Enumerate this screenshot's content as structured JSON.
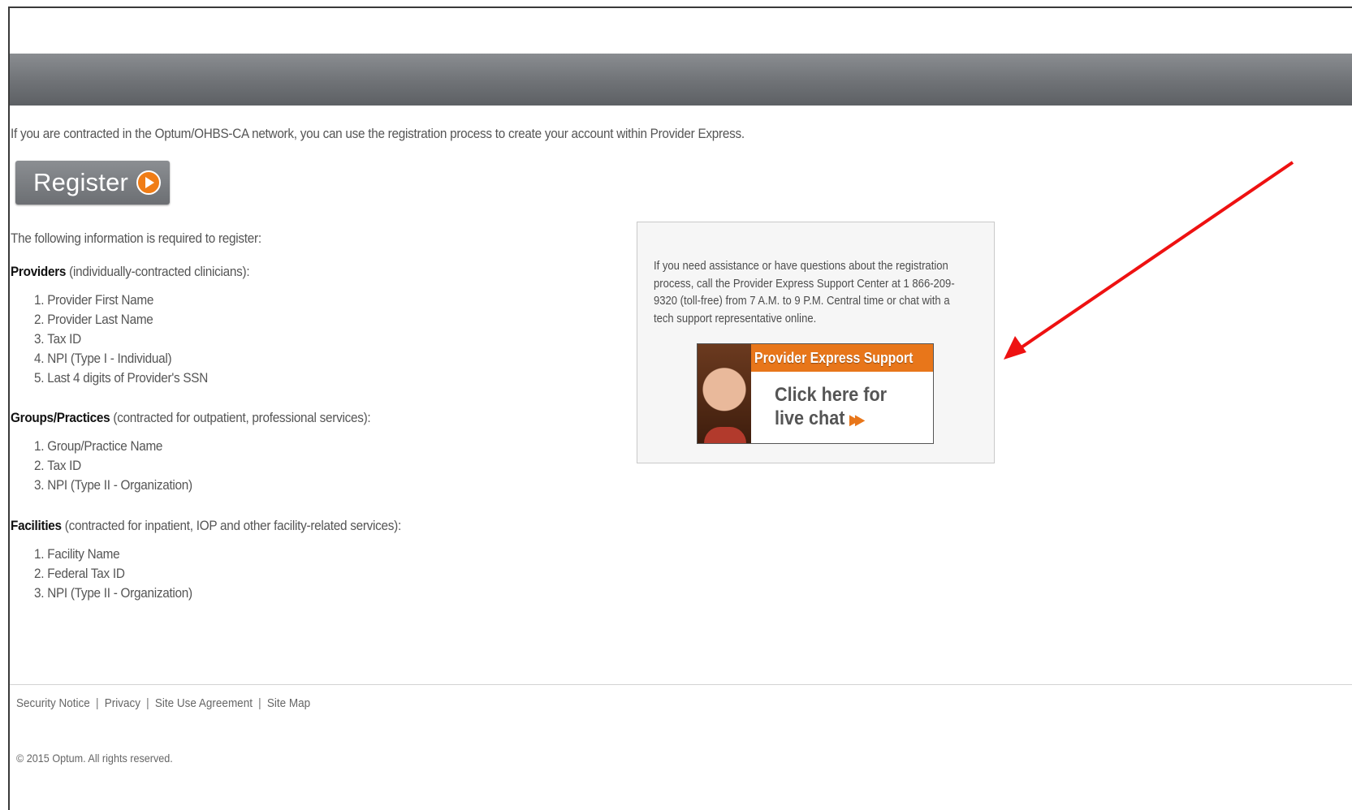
{
  "intro_text": "If you are contracted in the Optum/OHBS-CA network, you can use the registration process to create your account within Provider Express.",
  "register_label": "Register",
  "required_intro": "The following information is required to register:",
  "providers": {
    "heading": "Providers",
    "desc": " (individually-contracted clinicians):",
    "items": [
      "Provider First Name",
      "Provider Last Name",
      "Tax ID",
      "NPI (Type I - Individual)",
      "Last 4 digits of Provider's SSN"
    ]
  },
  "groups": {
    "heading": "Groups/Practices",
    "desc": " (contracted for outpatient, professional services):",
    "items": [
      "Group/Practice Name",
      "Tax ID",
      "NPI (Type II - Organization)"
    ]
  },
  "facilities": {
    "heading": "Facilities",
    "desc": " (contracted for inpatient, IOP and other facility-related services):",
    "items": [
      "Facility Name",
      "Federal Tax ID",
      "NPI (Type II - Organization)"
    ]
  },
  "support": {
    "text": "If you need assistance or have questions about the registration process, call the Provider Express Support Center at 1 866-209-9320 (toll-free) from 7 A.M. to 9 P.M. Central time or chat with a tech support representative online.",
    "banner_title": "Provider Express Support",
    "cta_line1": "Click here for",
    "cta_line2": "live chat"
  },
  "footer": {
    "links": [
      "Security Notice",
      "Privacy",
      "Site Use Agreement",
      "Site Map"
    ],
    "copyright": "© 2015 Optum. All rights reserved."
  },
  "colors": {
    "accent_orange": "#e8761a",
    "header_gray": "#6f7276",
    "annotation_arrow": "#ee1111"
  }
}
